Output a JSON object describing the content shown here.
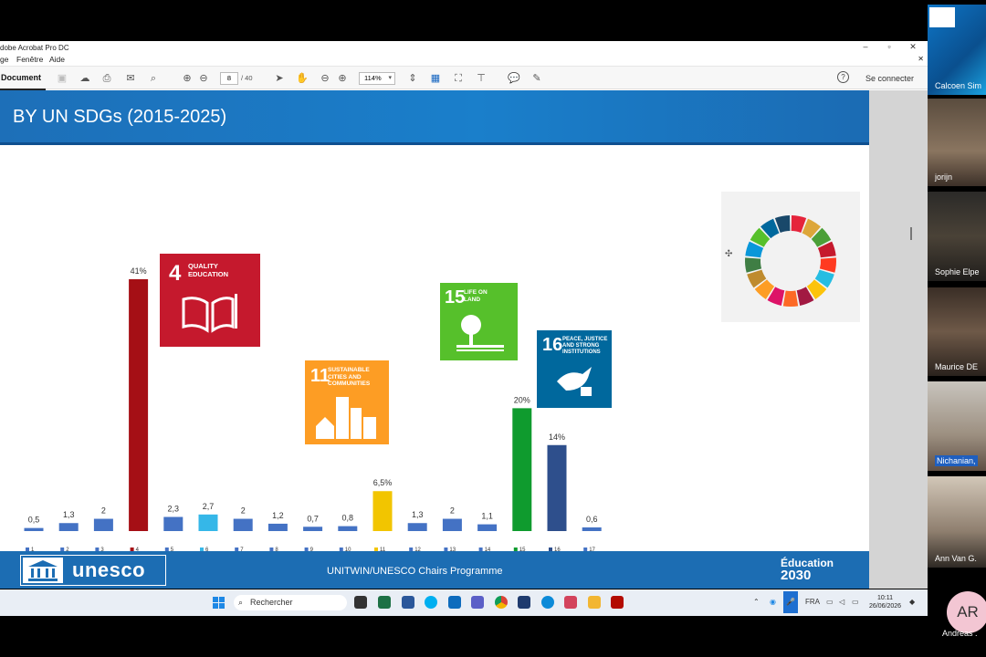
{
  "window": {
    "title": "dobe Acrobat Pro DC",
    "menu": [
      "ge",
      "Fenêtre",
      "Aide"
    ]
  },
  "toolbar": {
    "tab_label": "Document",
    "page_current": "8",
    "page_total": "/ 40",
    "zoom": "114%",
    "connect_label": "Se connecter"
  },
  "slide": {
    "title": "BY UN SDGs (2015-2025)",
    "footer_center": "UNITWIN/UNESCO Chairs Programme",
    "unesco_word": "unesco",
    "edu_line1": "Éducation",
    "edu_line2": "2030"
  },
  "sdg_tiles": [
    {
      "num": "4",
      "label": "QUALITY EDUCATION",
      "color": "#c5192d"
    },
    {
      "num": "11",
      "label": "SUSTAINABLE CITIES AND COMMUNITIES",
      "color": "#fd9d24"
    },
    {
      "num": "15",
      "label": "LIFE ON LAND",
      "color": "#56c02b"
    },
    {
      "num": "16",
      "label": "PEACE, JUSTICE AND STRONG INSTITUTIONS",
      "color": "#00689d"
    }
  ],
  "chart_data": {
    "type": "bar",
    "categories": [
      "1",
      "2",
      "3",
      "4",
      "5",
      "6",
      "7",
      "8",
      "9",
      "10",
      "11",
      "12",
      "13",
      "14",
      "15",
      "16",
      "17"
    ],
    "values": [
      0.5,
      1.3,
      2,
      41,
      2.3,
      2.7,
      2,
      1.2,
      0.7,
      0.8,
      6.5,
      1.3,
      2,
      1.1,
      20,
      14,
      0.6
    ],
    "data_labels": [
      "0,5",
      "1,3",
      "2",
      "41%",
      "2,3",
      "2,7",
      "2",
      "1,2",
      "0,7",
      "0,8",
      "6,5%",
      "1,3",
      "2",
      "1,1",
      "20%",
      "14%",
      "0,6"
    ],
    "colors": [
      "#4472c4",
      "#4472c4",
      "#4472c4",
      "#a50f15",
      "#4472c4",
      "#35b7e8",
      "#4472c4",
      "#4472c4",
      "#4472c4",
      "#4472c4",
      "#f2c500",
      "#4472c4",
      "#4472c4",
      "#4472c4",
      "#0f9b2e",
      "#2e4f8c",
      "#4472c4"
    ],
    "title": "BY UN SDGs (2015-2025)",
    "ylim": [
      0,
      41
    ],
    "grid": false,
    "legend": "bottom"
  },
  "taskbar": {
    "search_placeholder": "Rechercher",
    "lang": "FRA",
    "time": "10:11",
    "date": "26/06/2026"
  },
  "participants": [
    {
      "name": "Calcoen Sim"
    },
    {
      "name": "jorijn"
    },
    {
      "name": "Sophie Elpe"
    },
    {
      "name": "Maurice DE"
    },
    {
      "name": "Nichanian,"
    },
    {
      "name": "Ann Van G."
    }
  ],
  "avatar": {
    "initials": "AR",
    "name": "Andreas ."
  }
}
